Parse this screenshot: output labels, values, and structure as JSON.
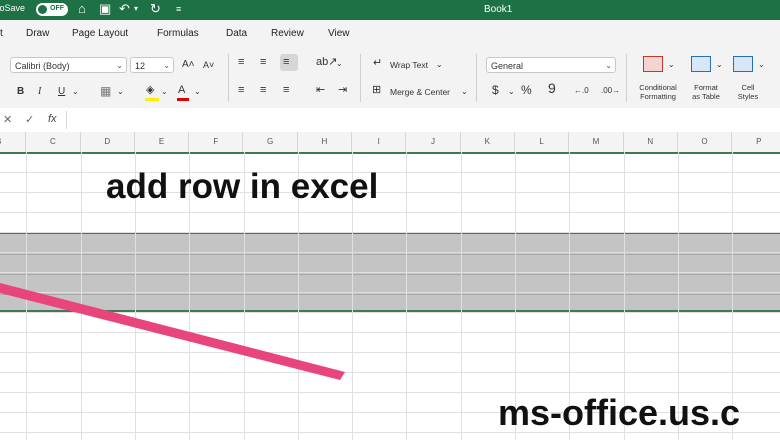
{
  "titlebar": {
    "autosave_label": "AutoSave",
    "toggle_state": "OFF",
    "document_title": "Book1"
  },
  "tabs": [
    "Draw",
    "Page Layout",
    "Formulas",
    "Data",
    "Review",
    "View"
  ],
  "ribbon": {
    "font_name": "Calibri (Body)",
    "font_size": "12",
    "wrap_text": "Wrap Text",
    "merge_center": "Merge & Center",
    "number_format": "General",
    "conditional_formatting": [
      "Conditional",
      "Formatting"
    ],
    "format_as_table": [
      "Format",
      "as Table"
    ],
    "cell_styles": [
      "Cell",
      "Styles"
    ]
  },
  "formula_bar": {
    "fx_label": "fx"
  },
  "columns": [
    "B",
    "C",
    "D",
    "E",
    "F",
    "G",
    "H",
    "I",
    "J",
    "K",
    "L",
    "M",
    "N",
    "O",
    "P"
  ],
  "overlay": {
    "title": "add row in excel",
    "site": "ms-office.us.c"
  },
  "colors": {
    "excel_green": "#1e7145",
    "selection_border": "#3f7b52",
    "selection_fill": "#c4c4c4",
    "arrow": "#e8457a"
  }
}
